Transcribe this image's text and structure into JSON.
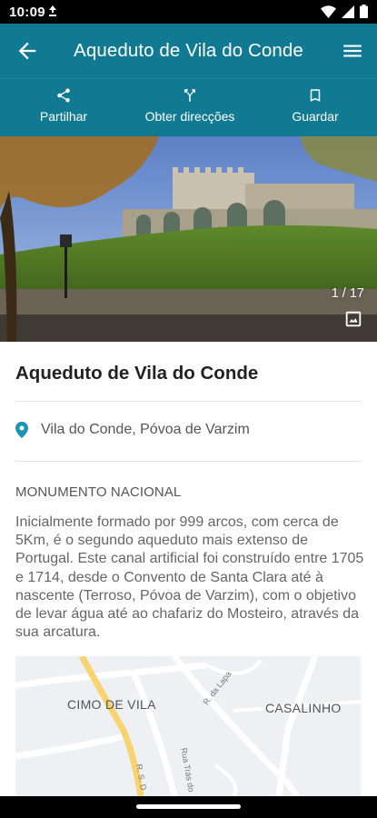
{
  "status_bar": {
    "time": "10:09"
  },
  "app_bar": {
    "title": "Aqueduto de Vila do Conde"
  },
  "actions": {
    "share_label": "Partilhar",
    "directions_label": "Obter direcções",
    "save_label": "Guardar"
  },
  "gallery": {
    "counter": "1 / 17"
  },
  "place": {
    "title": "Aqueduto de Vila do Conde",
    "location": "Vila do Conde, Póvoa de Varzim",
    "category": "MONUMENTO NACIONAL",
    "description": "Inicialmente formado por 999 arcos, com cerca de 5Km, é o segundo aqueduto mais extenso de Portugal. Este canal artificial foi construído entre 1705 e 1714, desde o Convento de Santa Clara até à nascente (Terroso, Póvoa de Varzim), com o objetivo de levar água até ao chafariz do Mosteiro, através da sua arcatura."
  },
  "map": {
    "labels": {
      "cimo_de_vila": "CIMO DE VILA",
      "casalinho": "CASALINHO",
      "r_da_lapa": "R. da Lapa",
      "rua_tras": "Rua Trás do",
      "r_s_d": "R. S. D"
    }
  },
  "colors": {
    "primary": "#0f7a92",
    "pin": "#1a94b0"
  },
  "icons": {
    "back": "arrow-back-icon",
    "menu": "hamburger-menu-icon",
    "share": "share-icon",
    "directions": "directions-icon",
    "save": "bookmark-icon",
    "gallery": "photo-gallery-icon",
    "location": "location-pin-icon"
  }
}
